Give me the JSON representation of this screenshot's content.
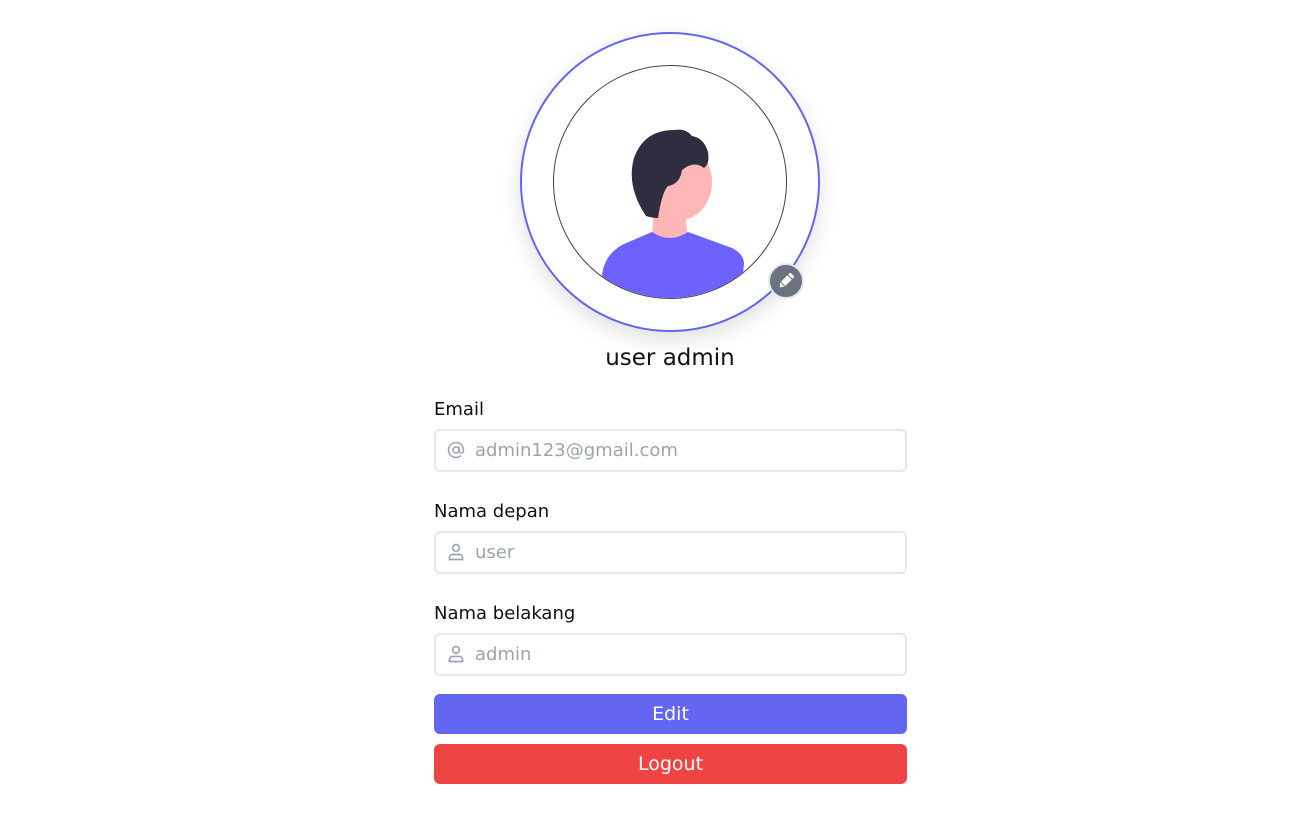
{
  "profile": {
    "display_name": "user admin",
    "avatar_icon": "user-avatar-illustration",
    "edit_avatar_icon": "pencil-icon"
  },
  "form": {
    "email": {
      "label": "Email",
      "placeholder": "admin123@gmail.com",
      "value": "",
      "icon": "at-sign-icon"
    },
    "first_name": {
      "label": "Nama depan",
      "placeholder": "user",
      "value": "",
      "icon": "user-icon"
    },
    "last_name": {
      "label": "Nama belakang",
      "placeholder": "admin",
      "value": "",
      "icon": "user-icon"
    }
  },
  "buttons": {
    "edit_label": "Edit",
    "logout_label": "Logout"
  },
  "colors": {
    "accent": "#6366f1",
    "danger": "#ef4444",
    "avatar_shirt": "#6c63ff",
    "avatar_hair": "#2f2e41",
    "avatar_skin": "#ffb6b6"
  }
}
